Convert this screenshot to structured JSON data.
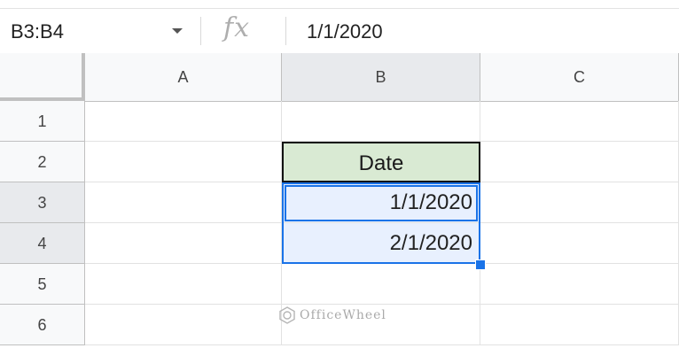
{
  "formula_bar": {
    "name_box": "B3:B4",
    "fx_label": "fx",
    "formula": "1/1/2020"
  },
  "columns": [
    "A",
    "B",
    "C"
  ],
  "rows": [
    {
      "num": "1",
      "a": "",
      "b": "",
      "c": ""
    },
    {
      "num": "2",
      "a": "",
      "b": "Date",
      "c": ""
    },
    {
      "num": "3",
      "a": "",
      "b": "1/1/2020",
      "c": ""
    },
    {
      "num": "4",
      "a": "",
      "b": "2/1/2020",
      "c": ""
    },
    {
      "num": "5",
      "a": "",
      "b": "",
      "c": ""
    },
    {
      "num": "6",
      "a": "",
      "b": "",
      "c": ""
    }
  ],
  "watermark": "OfficeWheel",
  "colors": {
    "selection": "#1a73e8",
    "header_fill": "#d9ead3",
    "selected_fill": "#e8f0fe"
  }
}
